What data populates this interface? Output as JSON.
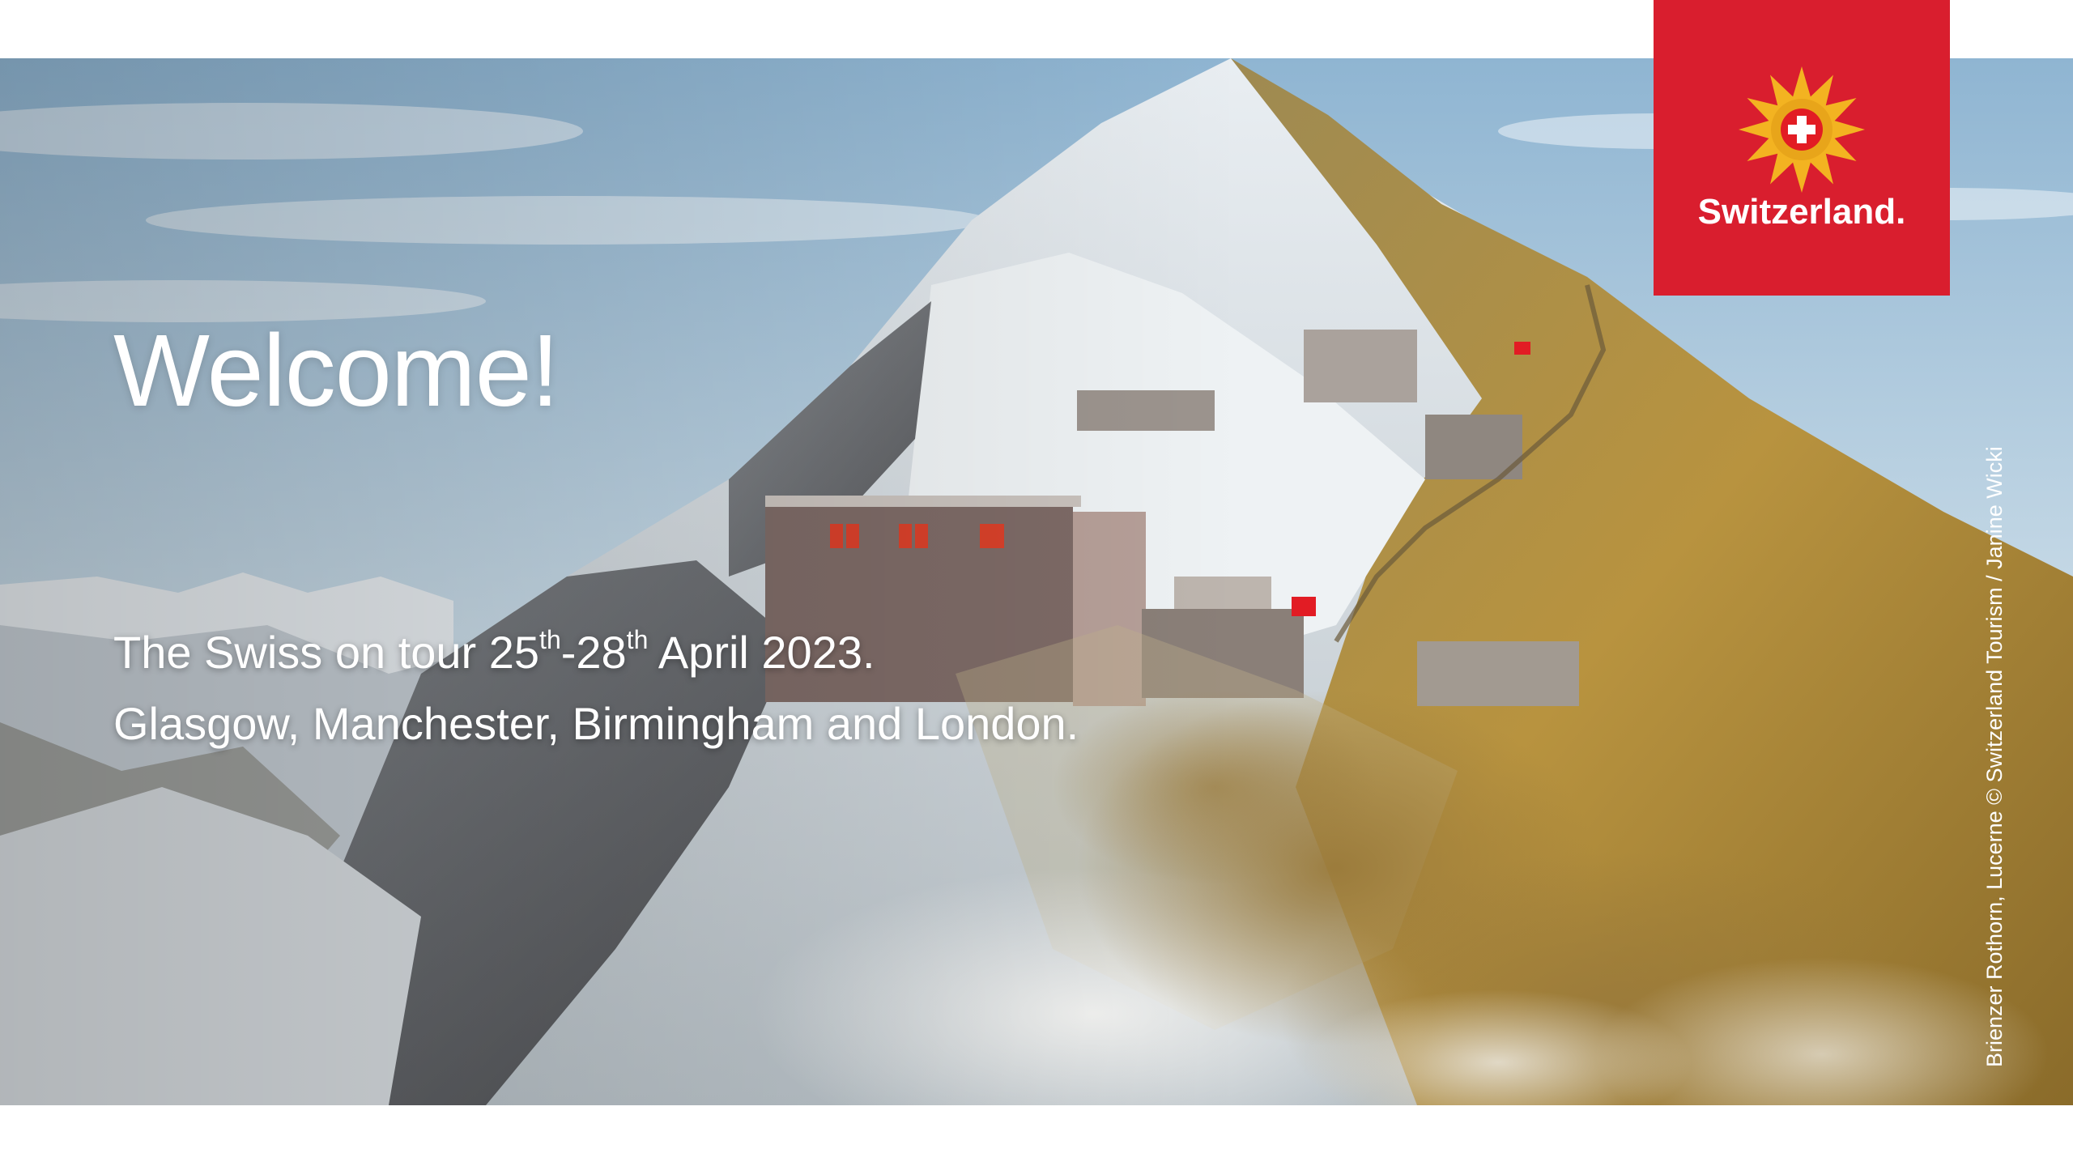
{
  "slide": {
    "welcome": "Welcome!",
    "tour": {
      "prefix": "The Swiss on tour 25",
      "sup1": "th",
      "mid": "-28",
      "sup2": "th",
      "suffix": " April 2023."
    },
    "cities": "Glasgow, Manchester, Birmingham and London.",
    "credit": "Brienzer Rothorn, Lucerne © Switzerland Tourism / Janine Wicki"
  },
  "logo": {
    "text": "Switzerland.",
    "icon": "swiss-flower-icon",
    "colors": {
      "background": "#d91e2e",
      "flower": "#f3b321",
      "cross": "#ffffff"
    }
  },
  "colors": {
    "sky": "#9fc0d8",
    "meadow": "#b08f3c",
    "snow": "#eef2f5",
    "rock": "#5e5e60"
  }
}
